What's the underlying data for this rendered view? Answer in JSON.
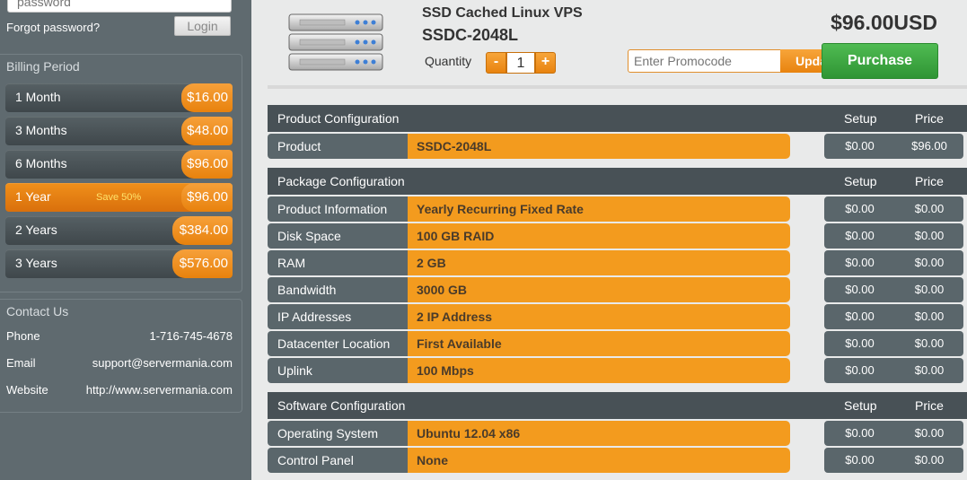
{
  "login": {
    "password_placeholder": "password",
    "forgot_label": "Forgot password?",
    "login_label": "Login"
  },
  "billing": {
    "title": "Billing Period",
    "periods": [
      {
        "label": "1 Month",
        "price": "$16.00",
        "save": "",
        "active": false
      },
      {
        "label": "3 Months",
        "price": "$48.00",
        "save": "",
        "active": false
      },
      {
        "label": "6 Months",
        "price": "$96.00",
        "save": "",
        "active": false
      },
      {
        "label": "1 Year",
        "price": "$96.00",
        "save": "Save 50%",
        "active": true
      },
      {
        "label": "2 Years",
        "price": "$384.00",
        "save": "",
        "active": false
      },
      {
        "label": "3 Years",
        "price": "$576.00",
        "save": "",
        "active": false
      }
    ]
  },
  "contact": {
    "title": "Contact Us",
    "rows": [
      {
        "label": "Phone",
        "value": "1-716-745-4678"
      },
      {
        "label": "Email",
        "value": "support@servermania.com"
      },
      {
        "label": "Website",
        "value": "http://www.servermania.com"
      }
    ]
  },
  "product": {
    "type": "SSD Cached Linux VPS",
    "name": "SSDC-2048L",
    "quantity_label": "Quantity",
    "quantity": "1",
    "minus": "-",
    "plus": "+",
    "total": "$96.00USD",
    "promo_placeholder": "Enter Promocode",
    "promo_button": "Update",
    "purchase_label": "Purchase"
  },
  "sections": [
    {
      "title": "Product Configuration",
      "setup_header": "Setup",
      "price_header": "Price",
      "rows": [
        {
          "label": "Product",
          "value": "SSDC-2048L",
          "setup": "$0.00",
          "price": "$96.00"
        }
      ]
    },
    {
      "title": "Package Configuration",
      "setup_header": "Setup",
      "price_header": "Price",
      "rows": [
        {
          "label": "Product Information",
          "value": "Yearly Recurring Fixed Rate",
          "setup": "$0.00",
          "price": "$0.00"
        },
        {
          "label": "Disk Space",
          "value": "100 GB RAID",
          "setup": "$0.00",
          "price": "$0.00"
        },
        {
          "label": "RAM",
          "value": "2 GB",
          "setup": "$0.00",
          "price": "$0.00"
        },
        {
          "label": "Bandwidth",
          "value": "3000 GB",
          "setup": "$0.00",
          "price": "$0.00"
        },
        {
          "label": "IP Addresses",
          "value": "2 IP Address",
          "setup": "$0.00",
          "price": "$0.00"
        },
        {
          "label": "Datacenter Location",
          "value": "First Available",
          "setup": "$0.00",
          "price": "$0.00"
        },
        {
          "label": "Uplink",
          "value": "100 Mbps",
          "setup": "$0.00",
          "price": "$0.00"
        }
      ]
    },
    {
      "title": "Software Configuration",
      "setup_header": "Setup",
      "price_header": "Price",
      "rows": [
        {
          "label": "Operating System",
          "value": "Ubuntu 12.04 x86",
          "setup": "$0.00",
          "price": "$0.00"
        },
        {
          "label": "Control Panel",
          "value": "None",
          "setup": "$0.00",
          "price": "$0.00"
        }
      ]
    }
  ],
  "colors": {
    "sidebar_bg": "#5f6a6f",
    "accent_orange": "#f39b1e",
    "header_dark": "#485156",
    "purchase_green": "#3aa43e"
  }
}
